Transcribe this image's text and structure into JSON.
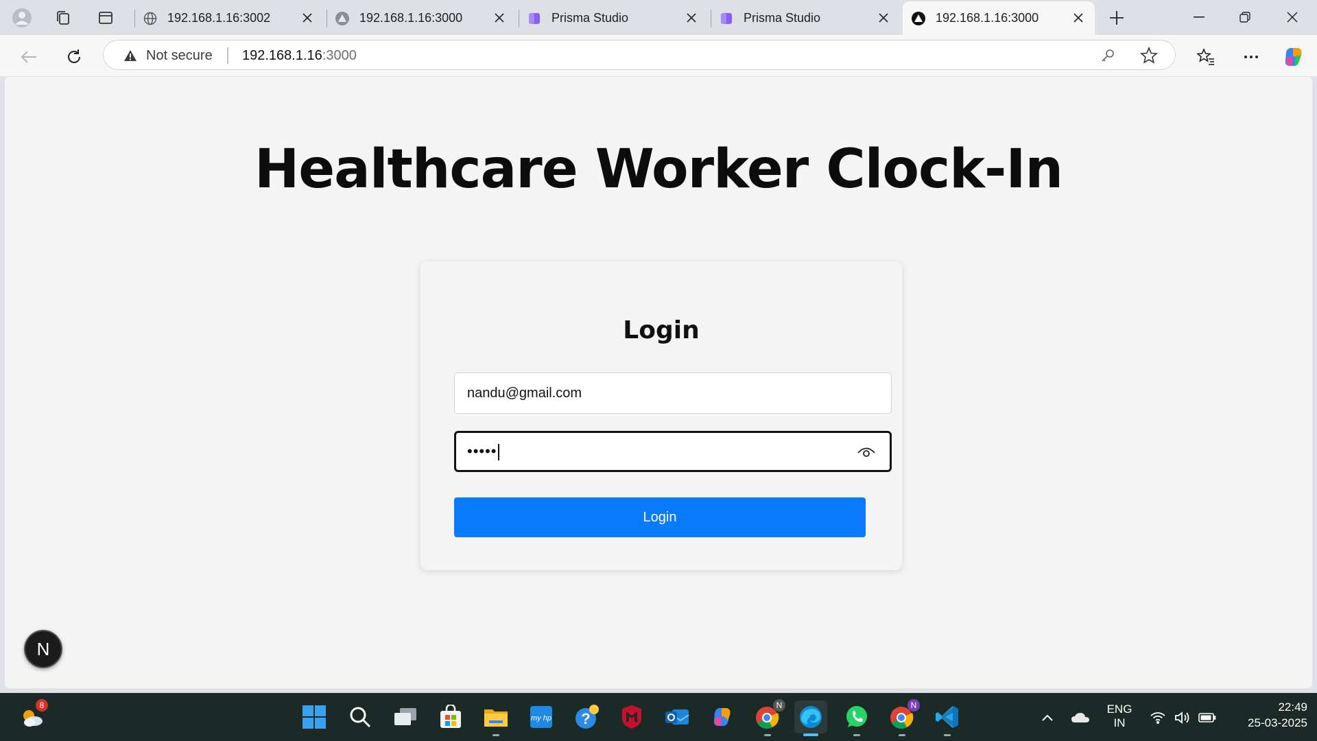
{
  "browser": {
    "tabs": [
      {
        "title": "192.168.1.16:3002",
        "favicon": "globe-icon",
        "active": false
      },
      {
        "title": "192.168.1.16:3000",
        "favicon": "vercel-triangle-icon",
        "active": false
      },
      {
        "title": "Prisma Studio",
        "favicon": "prisma-icon",
        "active": false
      },
      {
        "title": "Prisma Studio",
        "favicon": "prisma-icon",
        "active": false
      },
      {
        "title": "192.168.1.16:3000",
        "favicon": "vercel-triangle-icon",
        "active": true
      }
    ],
    "address": {
      "security_label": "Not secure",
      "host": "192.168.1.16",
      "port": ":3000"
    }
  },
  "page": {
    "title": "Healthcare Worker Clock-In",
    "login": {
      "heading": "Login",
      "email_value": "nandu@gmail.com",
      "password_masked": "•••••",
      "submit_label": "Login"
    },
    "dev_badge": "N"
  },
  "taskbar": {
    "weather_badge": "8",
    "language": {
      "line1": "ENG",
      "line2": "IN"
    },
    "clock": {
      "time": "22:49",
      "date": "25-03-2025"
    },
    "chrome_profile_badge": "N",
    "chrome2_profile_badge": "N"
  },
  "colors": {
    "accent": "#0a7aff",
    "taskbar_bg": "#1c2a27",
    "page_bg": "#f4f4f4"
  }
}
